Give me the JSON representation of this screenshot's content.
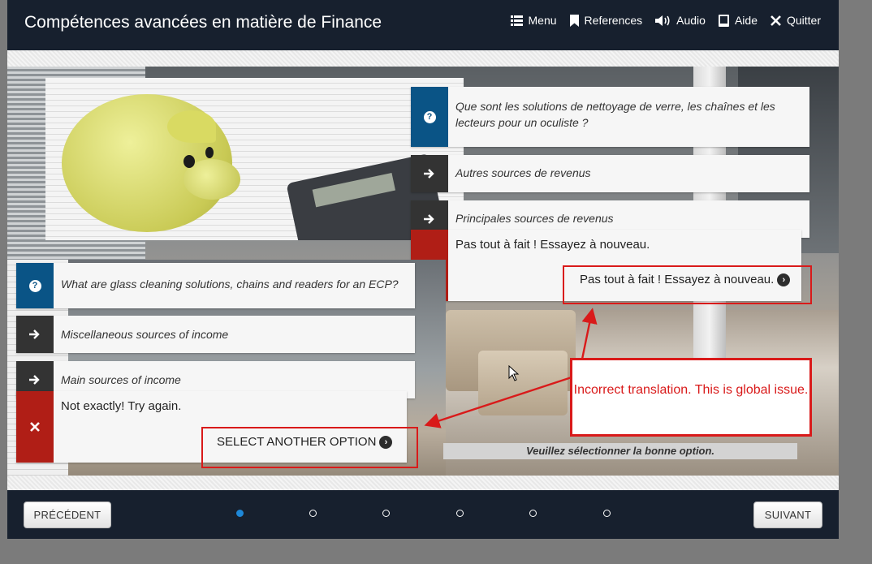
{
  "app": {
    "title": "Compétences avancées en matière de Finance"
  },
  "nav": [
    {
      "label": "Menu",
      "icon": "menu-icon"
    },
    {
      "label": "References",
      "icon": "bookmark-icon"
    },
    {
      "label": "Audio",
      "icon": "speaker-icon"
    },
    {
      "label": "Aide",
      "icon": "help-book-icon"
    },
    {
      "label": "Quitter",
      "icon": "close-icon"
    }
  ],
  "fr": {
    "question": "Que sont les solutions de nettoyage de verre, les chaînes et les lecteurs pour un oculiste ?",
    "option1": "Autres sources de revenus",
    "option2": "Principales sources de revenus",
    "feedback": "Pas tout à fait ! Essayez à nouveau.",
    "feedback_button": "Pas tout à fait ! Essayez à nouveau."
  },
  "en": {
    "question": "What are glass cleaning solutions, chains and readers for an ECP?",
    "option1": "Miscellaneous sources of income",
    "option2": "Main sources of income",
    "feedback": "Not exactly! Try again.",
    "feedback_button": "SELECT ANOTHER OPTION"
  },
  "hint": "Veuillez sélectionner la bonne option.",
  "annotation": "Incorrect translation. This is global issue.",
  "footer": {
    "prev": "PRÉCÉDENT",
    "next": "SUIVANT",
    "pages": 6,
    "active_page": 1
  },
  "colors": {
    "header_bg": "#17202e",
    "question_badge": "#0a5486",
    "arrow_badge": "#333333",
    "wrong_badge": "#b01e16",
    "annotation_red": "#d91a1a",
    "active_dot": "#1e88d8"
  }
}
